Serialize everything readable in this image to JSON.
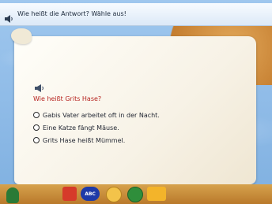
{
  "header": {
    "prompt": "Wie heißt die Antwort? Wähle aus!"
  },
  "question": {
    "text": "Wie heißt Grits Hase?",
    "options": [
      "Gabis Vater arbeitet oft in der Nacht.",
      "Eine Katze fängt Mäuse.",
      "Grits Hase heißt Mümmel."
    ]
  },
  "toolbar": {
    "keyboard_label": "ABC"
  },
  "colors": {
    "question": "#b6231f",
    "sky": "#9fc7ee",
    "parchment": "#f7f2e6"
  },
  "icons": {
    "header_speaker": "speaker-icon",
    "question_speaker": "speaker-icon"
  }
}
